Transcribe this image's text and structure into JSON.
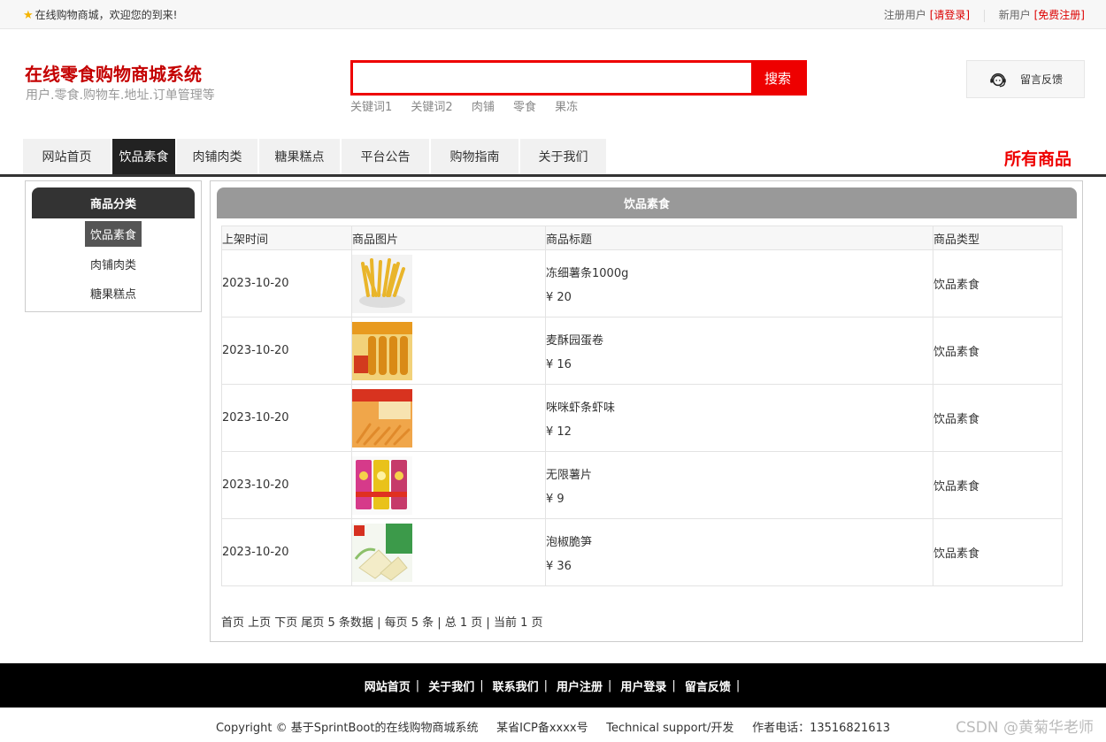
{
  "topbar": {
    "welcome": "在线购物商城，欢迎您的到来!",
    "register_user_label": "注册用户",
    "login_link": "[请登录]",
    "new_user_label": "新用户",
    "signup_link": "[免费注册]"
  },
  "header": {
    "logo_title": "在线零食购物商城系统",
    "logo_subtitle": "用户.零食.购物车.地址.订单管理等",
    "search_placeholder": "",
    "search_button": "搜索",
    "keywords": [
      "关键词1",
      "关键词2",
      "肉铺",
      "零食",
      "果冻"
    ],
    "feedback_label": "留言反馈"
  },
  "nav": {
    "items": [
      "网站首页",
      "饮品素食",
      "肉铺肉类",
      "糖果糕点",
      "平台公告",
      "购物指南",
      "关于我们"
    ],
    "active": "饮品素食",
    "all_goods": "所有商品"
  },
  "sidebar": {
    "title": "商品分类",
    "categories": [
      "饮品素食",
      "肉铺肉类",
      "糖果糕点"
    ],
    "active": "饮品素食"
  },
  "main": {
    "title": "饮品素食",
    "columns": [
      "上架时间",
      "商品图片",
      "商品标题",
      "商品类型"
    ],
    "rows": [
      {
        "date": "2023-10-20",
        "title": "冻细薯条1000g",
        "price": "¥ 20",
        "type": "饮品素食",
        "image": "fries"
      },
      {
        "date": "2023-10-20",
        "title": "麦酥园蛋卷",
        "price": "¥ 16",
        "type": "饮品素食",
        "image": "egg-rolls"
      },
      {
        "date": "2023-10-20",
        "title": "咪咪虾条虾味",
        "price": "¥ 12",
        "type": "饮品素食",
        "image": "shrimp-sticks"
      },
      {
        "date": "2023-10-20",
        "title": "无限薯片",
        "price": "¥ 9",
        "type": "饮品素食",
        "image": "potato-chips"
      },
      {
        "date": "2023-10-20",
        "title": "泡椒脆笋",
        "price": "¥ 36",
        "type": "饮品素食",
        "image": "bamboo-shoots"
      }
    ],
    "pager": "首页 上页 下页 尾页 5 条数据 | 每页 5 条 | 总 1 页 | 当前 1 页"
  },
  "footer": {
    "links": [
      "网站首页",
      "关于我们",
      "联系我们",
      "用户注册",
      "用户登录",
      "留言反馈"
    ],
    "copyright": "Copyright © 基于SprintBoot的在线购物商城系统     某省ICP备xxxx号     Technical support/开发     作者电话：13516821613",
    "watermark": "CSDN @黄菊华老师"
  },
  "colors": {
    "brand_red": "#e00000",
    "dark": "#222222",
    "gray_head": "#999999"
  }
}
